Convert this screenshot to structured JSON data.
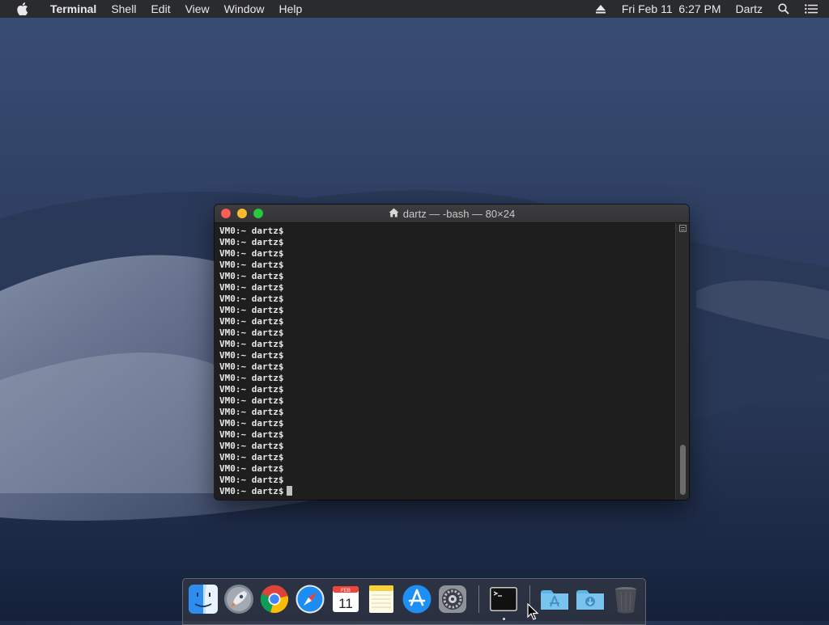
{
  "menubar": {
    "app_name": "Terminal",
    "menus": [
      "Shell",
      "Edit",
      "View",
      "Window",
      "Help"
    ],
    "datetime": "Fri Feb 11  6:27 PM",
    "user": "Dartz",
    "icons": [
      "apple-icon",
      "eject-icon",
      "spotlight-search-icon",
      "notification-center-icon"
    ]
  },
  "terminal": {
    "title": "dartz — -bash — 80×24",
    "title_icon": "home-folder-icon",
    "lines": [
      "VM0:~ dartz$",
      "VM0:~ dartz$",
      "VM0:~ dartz$",
      "VM0:~ dartz$",
      "VM0:~ dartz$",
      "VM0:~ dartz$",
      "VM0:~ dartz$",
      "VM0:~ dartz$",
      "VM0:~ dartz$",
      "VM0:~ dartz$",
      "VM0:~ dartz$",
      "VM0:~ dartz$",
      "VM0:~ dartz$",
      "VM0:~ dartz$",
      "VM0:~ dartz$",
      "VM0:~ dartz$",
      "VM0:~ dartz$",
      "VM0:~ dartz$",
      "VM0:~ dartz$",
      "VM0:~ dartz$",
      "VM0:~ dartz$",
      "VM0:~ dartz$",
      "VM0:~ dartz$",
      "VM0:~ dartz$"
    ]
  },
  "dock": {
    "apps": [
      {
        "name": "Finder",
        "icon": "finder-icon"
      },
      {
        "name": "Launchpad",
        "icon": "launchpad-icon"
      },
      {
        "name": "Google Chrome",
        "icon": "chrome-icon"
      },
      {
        "name": "Safari",
        "icon": "safari-icon"
      },
      {
        "name": "Calendar",
        "icon": "calendar-icon",
        "month": "FEB",
        "day": "11"
      },
      {
        "name": "Notes",
        "icon": "notes-icon"
      },
      {
        "name": "App Store",
        "icon": "app-store-icon"
      },
      {
        "name": "System Preferences",
        "icon": "system-preferences-icon"
      },
      {
        "name": "Terminal",
        "icon": "terminal-icon",
        "running": true
      },
      {
        "name": "Applications",
        "icon": "applications-folder-icon"
      },
      {
        "name": "Downloads",
        "icon": "downloads-folder-icon"
      },
      {
        "name": "Trash",
        "icon": "trash-icon"
      }
    ]
  },
  "colors": {
    "menubar_bg": "#2a2b2e",
    "terminal_bg": "#1e1e1e",
    "close": "#fc5f57",
    "minimize": "#fdbc2e",
    "maximize": "#28c840"
  }
}
